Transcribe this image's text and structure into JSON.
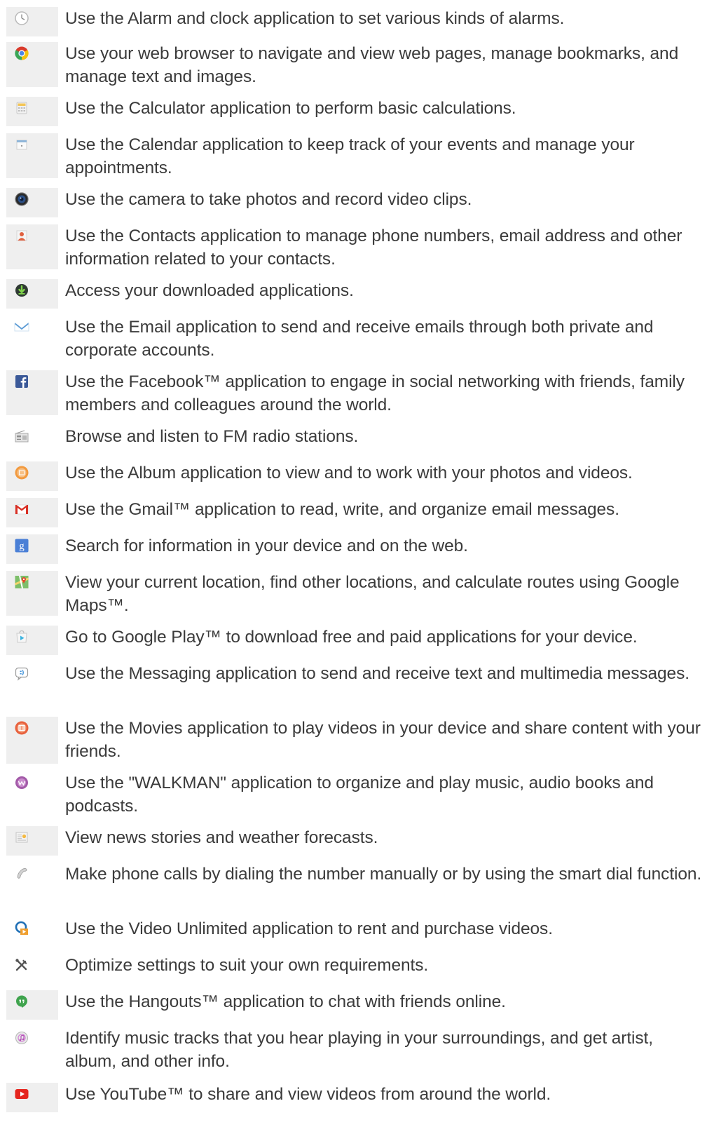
{
  "items": [
    {
      "icon": "alarm-clock-icon",
      "text": "Use the Alarm and clock application to set various kinds of alarms."
    },
    {
      "icon": "web-browser-icon",
      "text": "Use your web browser to navigate and view web pages, manage bookmarks, and manage text and images."
    },
    {
      "icon": "calculator-icon",
      "text": "Use the Calculator application to perform basic calculations."
    },
    {
      "icon": "calendar-icon",
      "text": "Use the Calendar application to keep track of your events and manage your appointments."
    },
    {
      "icon": "camera-icon",
      "text": "Use the camera to take photos and record video clips."
    },
    {
      "icon": "contacts-icon",
      "text": "Use the Contacts application to manage phone numbers, email address and other information related to your contacts."
    },
    {
      "icon": "downloads-icon",
      "text": "Access your downloaded applications."
    },
    {
      "icon": "email-icon",
      "text": "Use the Email application to send and receive emails through both private and corporate accounts."
    },
    {
      "icon": "facebook-icon",
      "text": "Use the Facebook™ application to engage in social networking with friends, family members and colleagues around the world."
    },
    {
      "icon": "fm-radio-icon",
      "text": "Browse and listen to FM radio stations."
    },
    {
      "icon": "album-icon",
      "text": "Use the Album application to view and to work with your photos and videos."
    },
    {
      "icon": "gmail-icon",
      "text": "Use the Gmail™ application to read, write, and organize email messages."
    },
    {
      "icon": "google-search-icon",
      "text": "Search for information in your device and on the web."
    },
    {
      "icon": "maps-icon",
      "text": "View your current location, find other locations, and calculate routes using Google Maps™."
    },
    {
      "icon": "play-store-icon",
      "text": "Go to Google Play™ to download free and paid applications for your device."
    },
    {
      "icon": "messaging-icon",
      "text": "Use the Messaging application to send and receive text and multimedia messages."
    },
    {
      "icon": "movies-icon",
      "text": "Use the Movies application to play videos in your device and share content with your friends."
    },
    {
      "icon": "walkman-icon",
      "text": "Use the \"WALKMAN\" application to organize and play music, audio books and podcasts."
    },
    {
      "icon": "news-weather-icon",
      "text": "View news stories and weather forecasts."
    },
    {
      "icon": "phone-icon",
      "text": "Make phone calls by dialing the number manually or by using the smart dial function."
    },
    {
      "icon": "video-unlimited-icon",
      "text": "Use the Video Unlimited application to rent and purchase videos."
    },
    {
      "icon": "settings-icon",
      "text": "Optimize settings to suit your own requirements."
    },
    {
      "icon": "hangouts-icon",
      "text": "Use the Hangouts™ application to chat with friends online."
    },
    {
      "icon": "trackid-icon",
      "text": "Identify music tracks that you hear playing in your surroundings, and get artist, album, and other info."
    },
    {
      "icon": "youtube-icon",
      "text": "Use YouTube™ to share and view videos from around the world."
    }
  ]
}
